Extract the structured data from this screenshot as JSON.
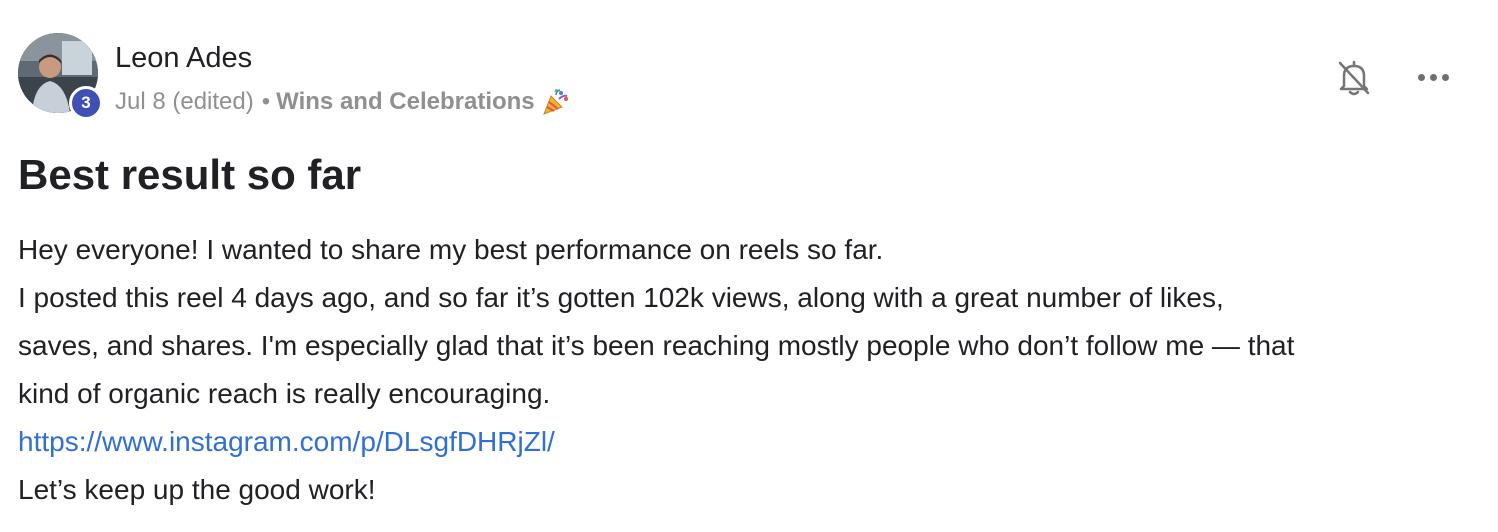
{
  "author": {
    "name": "Leon Ades",
    "level": "3"
  },
  "meta": {
    "date": "Jul 8 (edited)",
    "separator": "•",
    "category": "Wins and Celebrations",
    "category_icon": "party-popper-icon"
  },
  "actions": {
    "notify_icon": "bell-off-icon",
    "more_icon": "more-horizontal-icon"
  },
  "post": {
    "title": "Best result so far",
    "body": [
      "Hey everyone! I wanted to share my best performance on reels so far.",
      "I posted this reel 4 days ago, and so far it’s gotten 102k views, along with a great number of likes,",
      "saves, and shares. I'm especially glad that it’s been reaching mostly people who don’t follow me — that",
      "kind of organic reach is really encouraging."
    ],
    "link": "https://www.instagram.com/p/DLsgfDHRjZl/",
    "closing": "Let’s keep up the good work!"
  },
  "colors": {
    "badge": "#3f51b5",
    "link": "#2f6fd6",
    "meta": "#909090"
  }
}
